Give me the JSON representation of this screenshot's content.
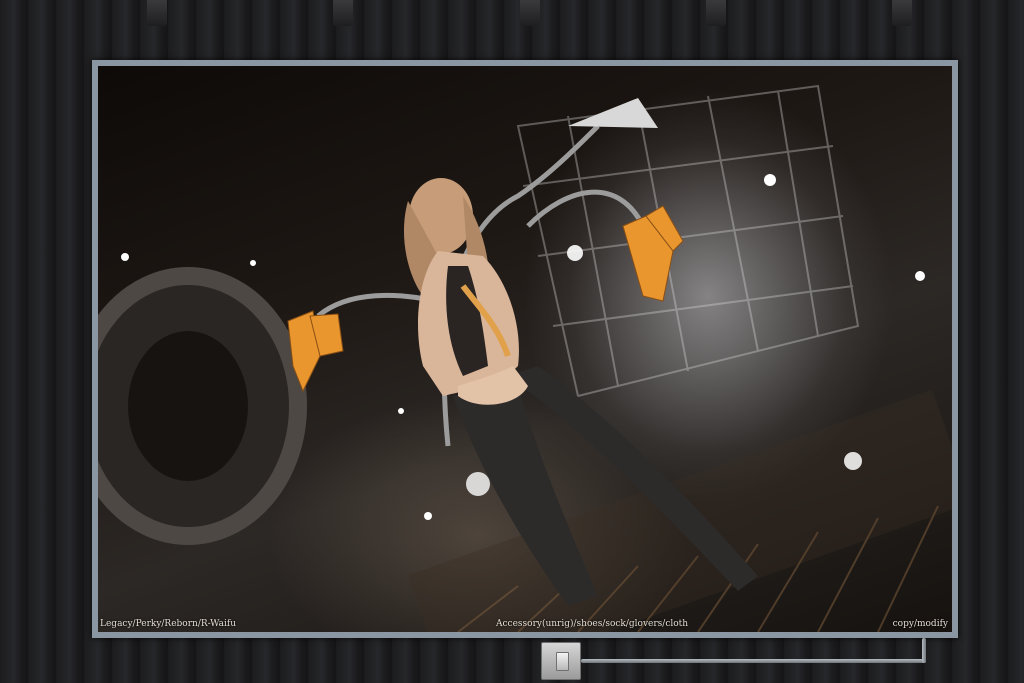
{
  "scene": {
    "wall": "dark-ribbed-wall",
    "fixtures_count": 5
  },
  "poster": {
    "frame_color": "#8a97a3",
    "image_subject": "female-avatar-render",
    "captions": {
      "left": "Legacy/Perky/Reborn/R-Waifu",
      "middle": "Accessory(unrig)/shoes/sock/glovers/cloth",
      "right": "copy/modify"
    }
  },
  "switch": {
    "icon": "light-switch-icon"
  },
  "colors": {
    "accent_orange": "#e9962f",
    "wall_dark": "#1c1c1e"
  }
}
